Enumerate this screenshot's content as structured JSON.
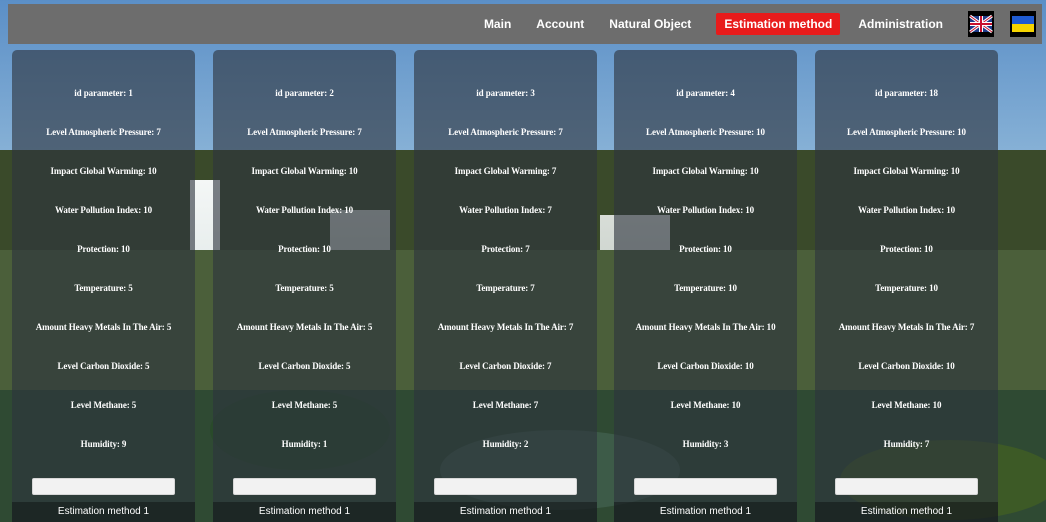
{
  "nav": {
    "items": [
      {
        "label": "Main",
        "active": false
      },
      {
        "label": "Account",
        "active": false
      },
      {
        "label": "Natural Object",
        "active": false
      },
      {
        "label": "Estimation method",
        "active": true
      },
      {
        "label": "Administration",
        "active": false
      }
    ],
    "accent_color": "#e81b1b",
    "languages": [
      "uk-flag-icon",
      "ukraine-flag-icon"
    ]
  },
  "cards": [
    {
      "id": "id parameter: 1",
      "pressure": "Level Atmospheric Pressure: 7",
      "warming": "Impact Global Warming: 10",
      "water": "Water Pollution Index: 10",
      "protection": "Protection: 10",
      "temperature": "Temperature: 5",
      "metals": "Amount Heavy Metals In The Air: 5",
      "co2": "Level Carbon Dioxide: 5",
      "methane": "Level Methane: 5",
      "humidity": "Humidity: 9",
      "method": "Estimation method 1"
    },
    {
      "id": "id parameter: 2",
      "pressure": "Level Atmospheric Pressure: 7",
      "warming": "Impact Global Warming: 10",
      "water": "Water Pollution Index: 10",
      "protection": "Protection: 10",
      "temperature": "Temperature: 5",
      "metals": "Amount Heavy Metals In The Air: 5",
      "co2": "Level Carbon Dioxide: 5",
      "methane": "Level Methane: 5",
      "humidity": "Humidity: 1",
      "method": "Estimation method 1"
    },
    {
      "id": "id parameter: 3",
      "pressure": "Level Atmospheric Pressure: 7",
      "warming": "Impact Global Warming: 7",
      "water": "Water Pollution Index: 7",
      "protection": "Protection: 7",
      "temperature": "Temperature: 7",
      "metals": "Amount Heavy Metals In The Air: 7",
      "co2": "Level Carbon Dioxide: 7",
      "methane": "Level Methane: 7",
      "humidity": "Humidity: 2",
      "method": "Estimation method 1"
    },
    {
      "id": "id parameter: 4",
      "pressure": "Level Atmospheric Pressure: 10",
      "warming": "Impact Global Warming: 10",
      "water": "Water Pollution Index: 10",
      "protection": "Protection: 10",
      "temperature": "Temperature: 10",
      "metals": "Amount Heavy Metals In The Air: 10",
      "co2": "Level Carbon Dioxide: 10",
      "methane": "Level Methane: 10",
      "humidity": "Humidity: 3",
      "method": "Estimation method 1"
    },
    {
      "id": "id parameter: 18",
      "pressure": "Level Atmospheric Pressure: 10",
      "warming": "Impact Global Warming: 10",
      "water": "Water Pollution Index: 10",
      "protection": "Protection: 10",
      "temperature": "Temperature: 10",
      "metals": "Amount Heavy Metals In The Air: 7",
      "co2": "Level Carbon Dioxide: 10",
      "methane": "Level Methane: 10",
      "humidity": "Humidity: 7",
      "method": "Estimation method 1"
    }
  ]
}
